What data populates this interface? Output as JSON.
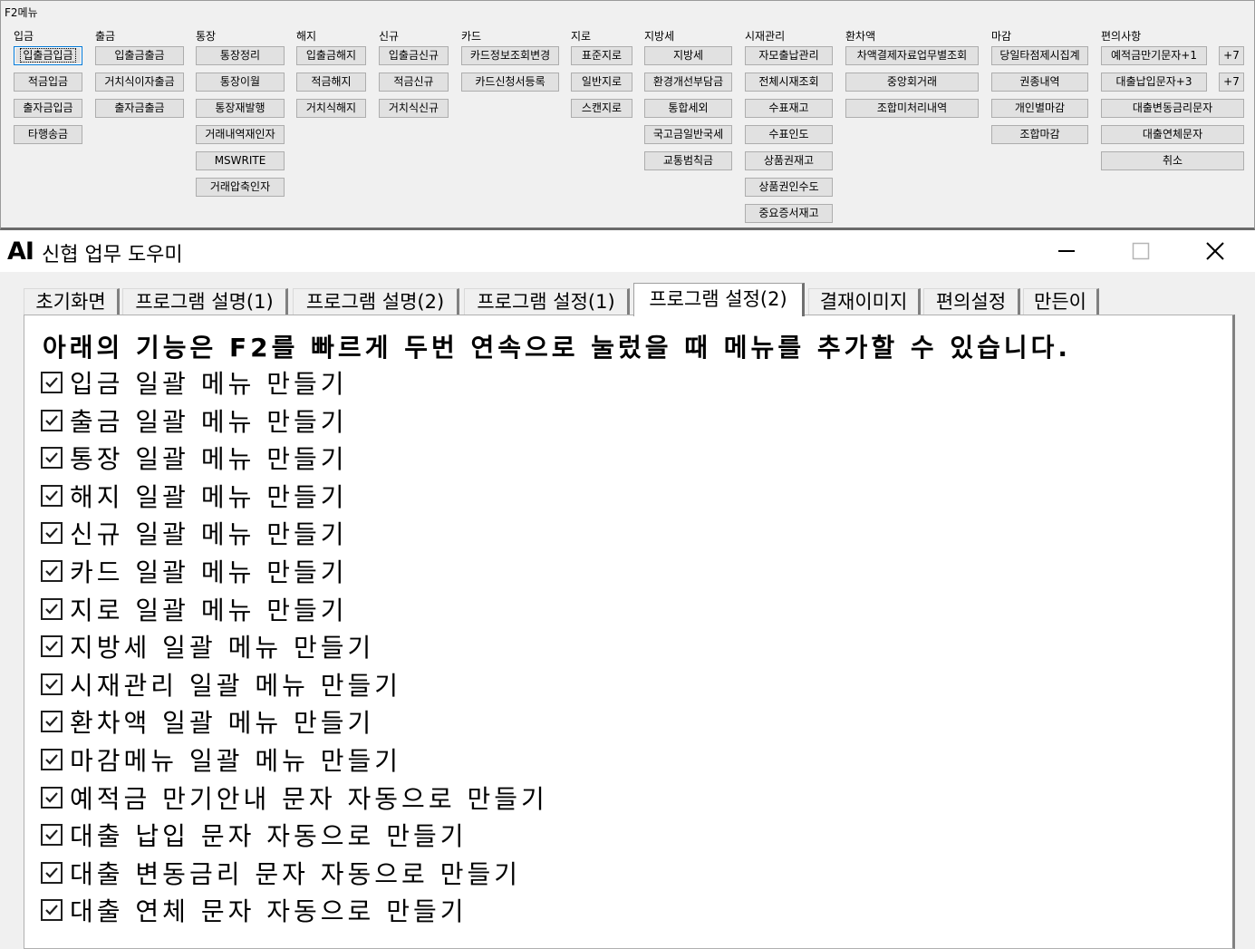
{
  "f2menu": {
    "title": "F2메뉴",
    "groups": [
      {
        "label": "입금",
        "buttons": [
          "입출금입금",
          "적금입금",
          "출자금입금",
          "타행송금"
        ]
      },
      {
        "label": "출금",
        "buttons": [
          "입출금출금",
          "거치식이자출금",
          "출자금출금"
        ]
      },
      {
        "label": "통장",
        "buttons": [
          "통장정리",
          "통장이월",
          "통장재발행",
          "거래내역재인자",
          "MSWRITE",
          "거래압축인자"
        ]
      },
      {
        "label": "해지",
        "buttons": [
          "입출금해지",
          "적금해지",
          "거치식해지"
        ]
      },
      {
        "label": "신규",
        "buttons": [
          "입출금신규",
          "적금신규",
          "거치식신규"
        ]
      },
      {
        "label": "카드",
        "buttons": [
          "카드정보조회변경",
          "카드신청서등록"
        ]
      },
      {
        "label": "지로",
        "buttons": [
          "표준지로",
          "일반지로",
          "스캔지로"
        ]
      },
      {
        "label": "지방세",
        "buttons": [
          "지방세",
          "환경개선부담금",
          "통합세외",
          "국고금일반국세",
          "교통범칙금"
        ]
      },
      {
        "label": "시재관리",
        "buttons": [
          "자모출납관리",
          "전체시재조회",
          "수표재고",
          "수표인도",
          "상품권재고",
          "상품권인수도",
          "중요증서재고"
        ]
      },
      {
        "label": "환차액",
        "buttons": [
          "차액결제자료업무별조회",
          "중앙회거래",
          "조합미처리내역"
        ]
      },
      {
        "label": "마감",
        "buttons": [
          "당일타점제시집계",
          "권종내역",
          "개인별마감",
          "조합마감"
        ]
      },
      {
        "label": "편의사항",
        "buttons": [
          "예적금만기문자+1",
          "대출납입문자+3",
          "대출변동금리문자",
          "대출연체문자",
          "취소"
        ]
      }
    ],
    "extra_buttons": [
      "+7",
      "+7"
    ]
  },
  "app": {
    "logo": "AI",
    "title": "신협 업무 도우미",
    "window_controls": [
      "minimize-icon",
      "maximize-icon",
      "close-icon"
    ],
    "tabs": [
      "초기화면",
      "프로그램 설명(1)",
      "프로그램 설명(2)",
      "프로그램 설정(1)",
      "프로그램 설정(2)",
      "결재이미지",
      "편의설정",
      "만든이"
    ],
    "active_tab": 4,
    "panel": {
      "heading": "아래의 기능은 F2를 빠르게 두번 연속으로 눌렀을 때 메뉴를 추가할 수 있습니다.",
      "options": [
        {
          "label": "입금 일괄 메뉴 만들기",
          "checked": true
        },
        {
          "label": "출금 일괄 메뉴 만들기",
          "checked": true
        },
        {
          "label": "통장 일괄 메뉴 만들기",
          "checked": true
        },
        {
          "label": "해지 일괄 메뉴 만들기",
          "checked": true
        },
        {
          "label": "신규 일괄 메뉴 만들기",
          "checked": true
        },
        {
          "label": "카드 일괄 메뉴 만들기",
          "checked": true
        },
        {
          "label": "지로 일괄 메뉴 만들기",
          "checked": true
        },
        {
          "label": "지방세 일괄 메뉴 만들기",
          "checked": true
        },
        {
          "label": "시재관리 일괄 메뉴 만들기",
          "checked": true
        },
        {
          "label": "환차액 일괄 메뉴 만들기",
          "checked": true
        },
        {
          "label": "마감메뉴 일괄 메뉴 만들기",
          "checked": true
        },
        {
          "label": "예적금 만기안내 문자 자동으로 만들기",
          "checked": true
        },
        {
          "label": "대출 납입 문자 자동으로 만들기",
          "checked": true
        },
        {
          "label": "대출 변동금리 문자 자동으로 만들기",
          "checked": true
        },
        {
          "label": "대출 연체 문자 자동으로 만들기",
          "checked": true
        }
      ]
    }
  }
}
